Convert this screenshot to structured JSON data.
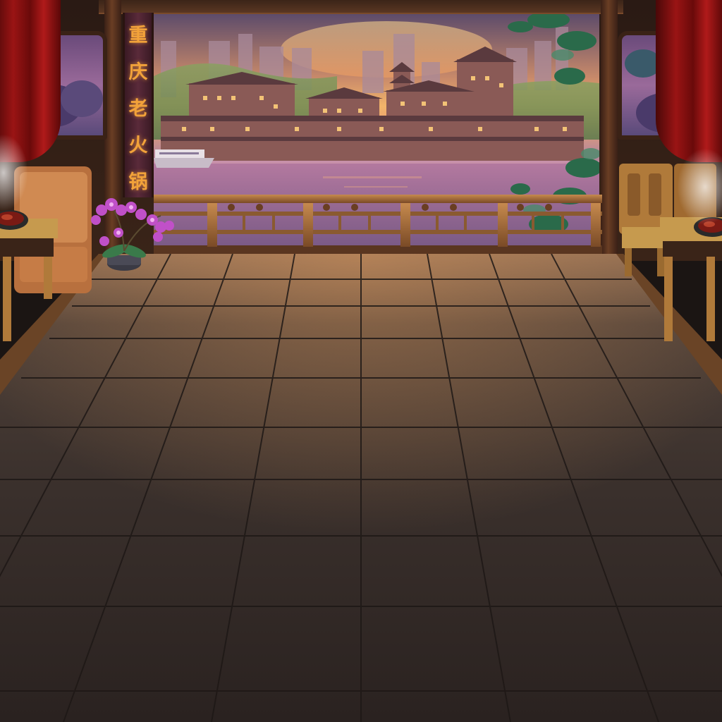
{
  "scene": {
    "name": "hotpot-restaurant-balcony",
    "sign": {
      "characters": [
        "重",
        "庆",
        "老",
        "火",
        "锅"
      ]
    }
  },
  "colors": {
    "sign_text": "#f2a23a",
    "sign_board": "#5a2a3a",
    "curtain": "#9a1414",
    "floor_tile": "#3a302c",
    "wood": "#8a5a30",
    "sky_glow": "#f2b46a"
  },
  "icons": {
    "plant": "orchid-plant-icon",
    "hotpot": "hotpot-bowl-icon",
    "boat": "ferry-boat-icon"
  }
}
